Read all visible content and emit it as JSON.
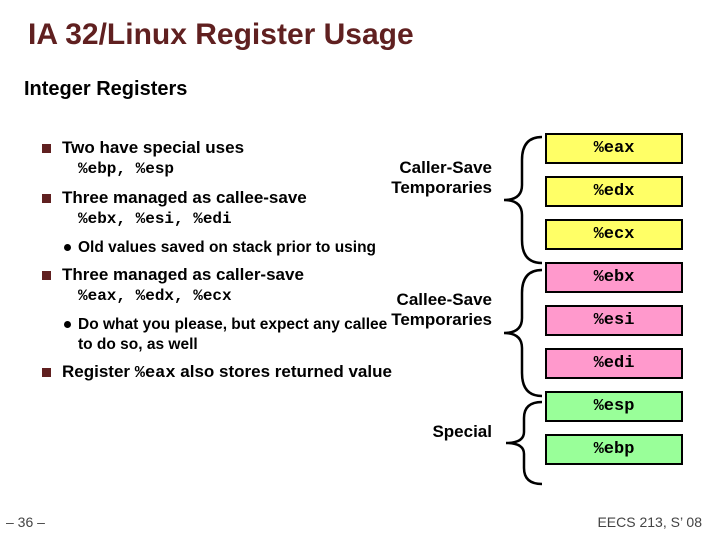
{
  "title": "IA 32/Linux Register Usage",
  "subtitle": "Integer Registers",
  "bullets": {
    "b1a": "Two have special uses",
    "b1a_sub": "%ebp, %esp",
    "b1b": "Three managed as callee-save",
    "b1b_sub": "%ebx, %esi, %edi",
    "b1b_note": "Old values saved on stack prior to using",
    "b1c": "Three managed as caller-save",
    "b1c_sub": "%eax, %edx, %ecx",
    "b1c_note": "Do what you please, but expect any callee to do so, as well",
    "b1d_pre": "Register ",
    "b1d_reg": "%eax",
    "b1d_post": "  also stores returned value"
  },
  "groups": {
    "caller": "Caller-Save Temporaries",
    "callee": "Callee-Save Temporaries",
    "special": "Special"
  },
  "registers": {
    "eax": "%eax",
    "edx": "%edx",
    "ecx": "%ecx",
    "ebx": "%ebx",
    "esi": "%esi",
    "edi": "%edi",
    "esp": "%esp",
    "ebp": "%ebp"
  },
  "footer": {
    "left": "– 36 –",
    "right": "EECS 213, S’ 08"
  }
}
